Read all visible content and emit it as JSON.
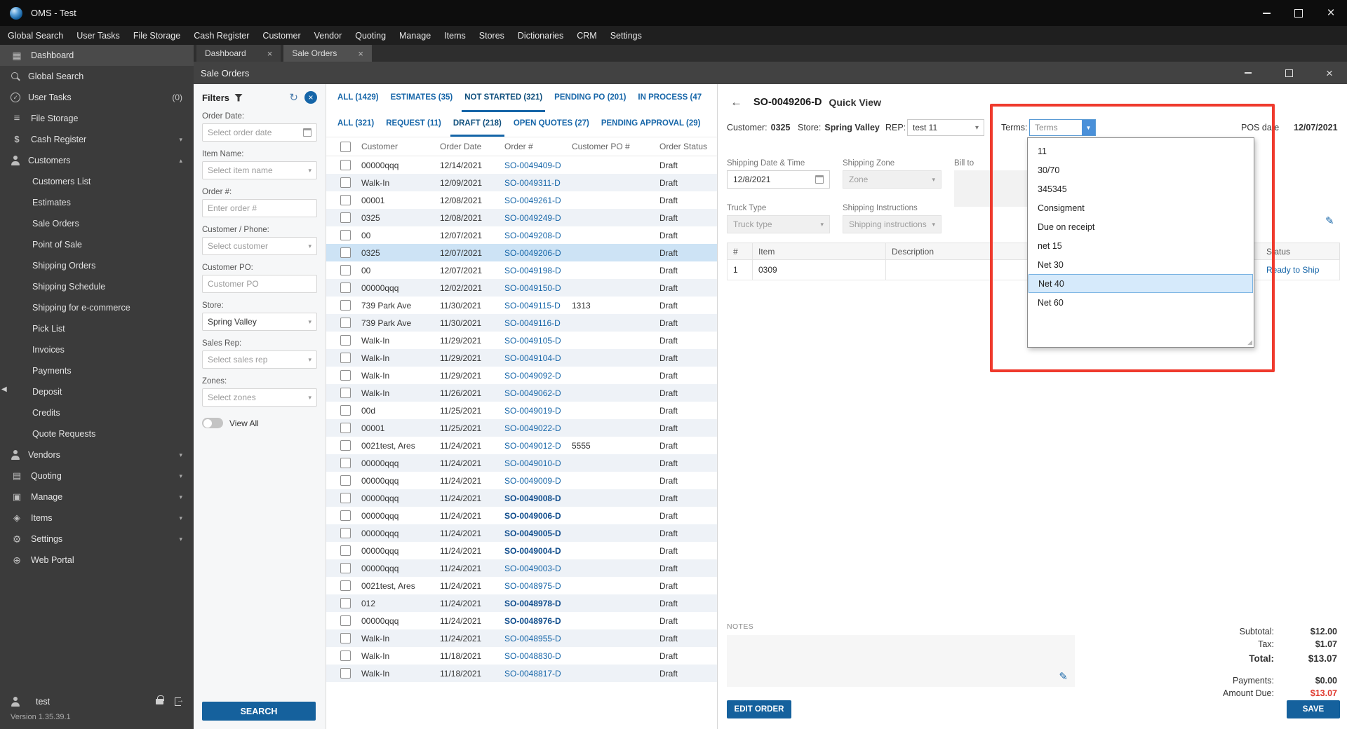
{
  "titlebar": {
    "title": "OMS - Test"
  },
  "menubar": {
    "items": [
      "Global Search",
      "User Tasks",
      "File Storage",
      "Cash Register",
      "Customer",
      "Vendor",
      "Quoting",
      "Manage",
      "Items",
      "Stores",
      "Dictionaries",
      "CRM",
      "Settings"
    ]
  },
  "tabs": {
    "dashboard": "Dashboard",
    "sale_orders": "Sale Orders"
  },
  "so_header": {
    "title": "Sale Orders"
  },
  "sidebar": {
    "dashboard": "Dashboard",
    "global_search": "Global Search",
    "user_tasks": "User Tasks",
    "user_tasks_badge": "(0)",
    "file_storage": "File Storage",
    "cash_register": "Cash Register",
    "customers": "Customers",
    "customers_sub": [
      "Customers List",
      "Estimates",
      "Sale Orders",
      "Point of Sale",
      "Shipping Orders",
      "Shipping Schedule",
      "Shipping for e-commerce",
      "Pick List",
      "Invoices",
      "Payments",
      "Deposit",
      "Credits",
      "Quote Requests"
    ],
    "vendors": "Vendors",
    "quoting": "Quoting",
    "manage": "Manage",
    "items": "Items",
    "settings": "Settings",
    "web_portal": "Web Portal",
    "user": "test",
    "version": "Version 1.35.39.1"
  },
  "filters": {
    "title": "Filters",
    "order_date": {
      "label": "Order Date:",
      "placeholder": "Select order date"
    },
    "item_name": {
      "label": "Item Name:",
      "placeholder": "Select item name"
    },
    "order_num": {
      "label": "Order #:",
      "placeholder": "Enter order #"
    },
    "customer": {
      "label": "Customer / Phone:",
      "placeholder": "Select customer"
    },
    "customer_po": {
      "label": "Customer PO:",
      "placeholder": "Customer PO"
    },
    "store": {
      "label": "Store:",
      "value": "Spring Valley"
    },
    "sales_rep": {
      "label": "Sales Rep:",
      "placeholder": "Select sales rep"
    },
    "zones": {
      "label": "Zones:",
      "placeholder": "Select zones"
    },
    "view_all": "View All",
    "search_button": "SEARCH"
  },
  "orders": {
    "status_tabs": [
      {
        "label": "ALL (1429)"
      },
      {
        "label": "ESTIMATES (35)"
      },
      {
        "label": "NOT STARTED (321)",
        "active": true
      },
      {
        "label": "PENDING PO (201)"
      },
      {
        "label": "IN PROCESS (47"
      }
    ],
    "sub_tabs": [
      {
        "label": "ALL (321)"
      },
      {
        "label": "REQUEST (11)"
      },
      {
        "label": "DRAFT (218)",
        "active": true
      },
      {
        "label": "OPEN QUOTES (27)"
      },
      {
        "label": "PENDING APPROVAL (29)"
      }
    ],
    "headers": [
      "Customer",
      "Order Date",
      "Order #",
      "Customer PO #",
      "Order Status"
    ],
    "rows": [
      {
        "customer": "00000qqq",
        "date": "12/14/2021",
        "order": "SO-0049409-D",
        "po": "",
        "status": "Draft"
      },
      {
        "customer": "Walk-In",
        "date": "12/09/2021",
        "order": "SO-0049311-D",
        "po": "",
        "status": "Draft"
      },
      {
        "customer": "00001",
        "date": "12/08/2021",
        "order": "SO-0049261-D",
        "po": "",
        "status": "Draft"
      },
      {
        "customer": "0325",
        "date": "12/08/2021",
        "order": "SO-0049249-D",
        "po": "",
        "status": "Draft"
      },
      {
        "customer": "00",
        "date": "12/07/2021",
        "order": "SO-0049208-D",
        "po": "",
        "status": "Draft"
      },
      {
        "customer": "0325",
        "date": "12/07/2021",
        "order": "SO-0049206-D",
        "po": "",
        "status": "Draft",
        "selected": true
      },
      {
        "customer": "00",
        "date": "12/07/2021",
        "order": "SO-0049198-D",
        "po": "",
        "status": "Draft"
      },
      {
        "customer": "00000qqq",
        "date": "12/02/2021",
        "order": "SO-0049150-D",
        "po": "",
        "status": "Draft"
      },
      {
        "customer": "739 Park Ave",
        "date": "11/30/2021",
        "order": "SO-0049115-D",
        "po": "1313",
        "status": "Draft"
      },
      {
        "customer": "739 Park Ave",
        "date": "11/30/2021",
        "order": "SO-0049116-D",
        "po": "",
        "status": "Draft"
      },
      {
        "customer": "Walk-In",
        "date": "11/29/2021",
        "order": "SO-0049105-D",
        "po": "",
        "status": "Draft"
      },
      {
        "customer": "Walk-In",
        "date": "11/29/2021",
        "order": "SO-0049104-D",
        "po": "",
        "status": "Draft"
      },
      {
        "customer": "Walk-In",
        "date": "11/29/2021",
        "order": "SO-0049092-D",
        "po": "",
        "status": "Draft"
      },
      {
        "customer": "Walk-In",
        "date": "11/26/2021",
        "order": "SO-0049062-D",
        "po": "",
        "status": "Draft"
      },
      {
        "customer": "00d",
        "date": "11/25/2021",
        "order": "SO-0049019-D",
        "po": "",
        "status": "Draft"
      },
      {
        "customer": "00001",
        "date": "11/25/2021",
        "order": "SO-0049022-D",
        "po": "",
        "status": "Draft"
      },
      {
        "customer": "0021test, Ares",
        "date": "11/24/2021",
        "order": "SO-0049012-D",
        "po": "5555",
        "status": "Draft"
      },
      {
        "customer": "00000qqq",
        "date": "11/24/2021",
        "order": "SO-0049010-D",
        "po": "",
        "status": "Draft"
      },
      {
        "customer": "00000qqq",
        "date": "11/24/2021",
        "order": "SO-0049009-D",
        "po": "",
        "status": "Draft"
      },
      {
        "customer": "00000qqq",
        "date": "11/24/2021",
        "order": "SO-0049008-D",
        "po": "",
        "status": "Draft",
        "bold": true
      },
      {
        "customer": "00000qqq",
        "date": "11/24/2021",
        "order": "SO-0049006-D",
        "po": "",
        "status": "Draft",
        "bold": true
      },
      {
        "customer": "00000qqq",
        "date": "11/24/2021",
        "order": "SO-0049005-D",
        "po": "",
        "status": "Draft",
        "bold": true
      },
      {
        "customer": "00000qqq",
        "date": "11/24/2021",
        "order": "SO-0049004-D",
        "po": "",
        "status": "Draft",
        "bold": true
      },
      {
        "customer": "00000qqq",
        "date": "11/24/2021",
        "order": "SO-0049003-D",
        "po": "",
        "status": "Draft"
      },
      {
        "customer": "0021test, Ares",
        "date": "11/24/2021",
        "order": "SO-0048975-D",
        "po": "",
        "status": "Draft"
      },
      {
        "customer": "012",
        "date": "11/24/2021",
        "order": "SO-0048978-D",
        "po": "",
        "status": "Draft",
        "bold": true
      },
      {
        "customer": "00000qqq",
        "date": "11/24/2021",
        "order": "SO-0048976-D",
        "po": "",
        "status": "Draft",
        "bold": true
      },
      {
        "customer": "Walk-In",
        "date": "11/24/2021",
        "order": "SO-0048955-D",
        "po": "",
        "status": "Draft"
      },
      {
        "customer": "Walk-In",
        "date": "11/18/2021",
        "order": "SO-0048830-D",
        "po": "",
        "status": "Draft"
      },
      {
        "customer": "Walk-In",
        "date": "11/18/2021",
        "order": "SO-0048817-D",
        "po": "",
        "status": "Draft"
      }
    ]
  },
  "quickview": {
    "title_order": "SO-0049206-D",
    "title_suffix": "Quick View",
    "customer_label": "Customer:",
    "customer_value": "0325",
    "store_label": "Store:",
    "store_value": "Spring Valley",
    "rep_label": "REP:",
    "rep_value": "test 11",
    "terms_label": "Terms:",
    "terms_placeholder": "Terms",
    "pos_date_label": "POS date",
    "pos_date_value": "12/07/2021",
    "terms_options": [
      {
        "label": "11"
      },
      {
        "label": "30/70"
      },
      {
        "label": "345345"
      },
      {
        "label": "Consigment"
      },
      {
        "label": "Due on receipt"
      },
      {
        "label": "net 15"
      },
      {
        "label": "Net 30"
      },
      {
        "label": "Net 40",
        "selected": true
      },
      {
        "label": "Net 60"
      }
    ],
    "shipping": {
      "date_label": "Shipping Date & Time",
      "date_value": "12/8/2021",
      "zone_label": "Shipping Zone",
      "zone_placeholder": "Zone",
      "billto_label": "Bill to",
      "truck_label": "Truck Type",
      "truck_placeholder": "Truck type",
      "instructions_label": "Shipping Instructions",
      "instructions_placeholder": "Shipping instructions"
    },
    "items_headers": [
      "#",
      "Item",
      "Description",
      "Status"
    ],
    "items_rows": [
      {
        "num": "1",
        "item": "0309",
        "description": "",
        "status": "Ready to Ship"
      }
    ],
    "notes_label": "NOTES",
    "totals": [
      {
        "label": "Subtotal:",
        "value": "$12.00"
      },
      {
        "label": "Tax:",
        "value": "$1.07"
      },
      {
        "label": "Total:",
        "value": "$13.07",
        "bold": true
      },
      {
        "label": "Payments:",
        "value": "$0.00",
        "gap": true
      },
      {
        "label": "Amount Due:",
        "value": "$13.07",
        "red": true
      }
    ],
    "edit_button": "EDIT ORDER",
    "save_button": "SAVE"
  },
  "icons": {
    "titlebar": [
      "app-logo-icon",
      "minimize-icon",
      "restore-icon",
      "close-icon"
    ],
    "filters": [
      "filter-funnel-icon",
      "refresh-icon",
      "clear-filters-icon",
      "calendar-icon",
      "chevron-down-icon",
      "view-all-toggle"
    ],
    "quickview": [
      "back-arrow-icon",
      "chevron-down-icon",
      "calendar-icon",
      "edit-pencil-icon",
      "notes-pencil-icon",
      "resize-grip-icon"
    ]
  }
}
